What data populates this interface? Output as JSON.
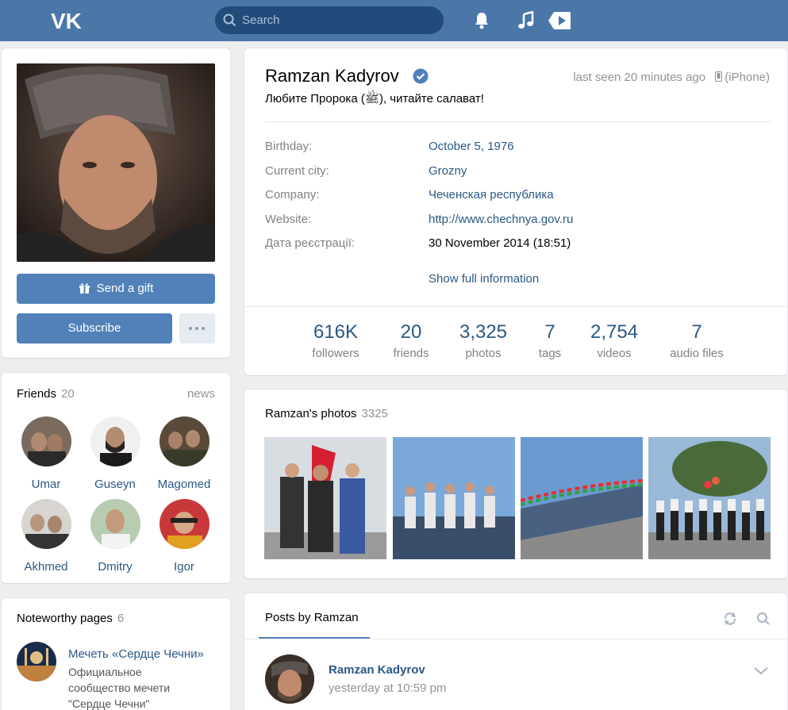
{
  "header": {
    "search_placeholder": "Search"
  },
  "avatar_card": {
    "gift_label": "Send a gift",
    "subscribe_label": "Subscribe"
  },
  "friends": {
    "title": "Friends",
    "count": "20",
    "news_label": "news",
    "items": [
      {
        "name": "Umar"
      },
      {
        "name": "Guseyn"
      },
      {
        "name": "Magomed"
      },
      {
        "name": "Akhmed"
      },
      {
        "name": "Dmitry"
      },
      {
        "name": "Igor"
      }
    ]
  },
  "noteworthy": {
    "title": "Noteworthy pages",
    "count": "6",
    "page_name": "Мечеть «Сердце Чечни»",
    "page_desc_1": "Официальное",
    "page_desc_2": "сообщество мечети",
    "page_desc_3": "\"Сердце Чечни\""
  },
  "profile": {
    "name": "Ramzan Kadyrov",
    "status": "Любите Пророка (ﷺ), читайте салават!",
    "last_seen": "last seen 20 minutes ago",
    "device": "(iPhone)",
    "rows": [
      {
        "label": "Birthday:",
        "value": "October 5, 1976"
      },
      {
        "label": "Current city:",
        "value": "Grozny"
      },
      {
        "label": "Company:",
        "value": "Чеченская республика"
      },
      {
        "label": "Website:",
        "value": "http://www.chechnya.gov.ru"
      },
      {
        "label": "Дата реєстрації:",
        "value": "30 November 2014 (18:51)"
      }
    ],
    "show_full": "Show full information",
    "counters": [
      {
        "num": "616K",
        "cap": "followers"
      },
      {
        "num": "20",
        "cap": "friends"
      },
      {
        "num": "3,325",
        "cap": "photos"
      },
      {
        "num": "7",
        "cap": "tags"
      },
      {
        "num": "2,754",
        "cap": "videos"
      },
      {
        "num": "7",
        "cap": "audio files"
      }
    ]
  },
  "photos": {
    "title": "Ramzan's photos",
    "count": "3325"
  },
  "posts": {
    "tab_label": "Posts by Ramzan",
    "author": "Ramzan Kadyrov",
    "time": "yesterday at 10:59 pm"
  },
  "colors": {
    "header_bg": "#4a76a8",
    "link": "#2a5885",
    "button": "#5181b8"
  }
}
